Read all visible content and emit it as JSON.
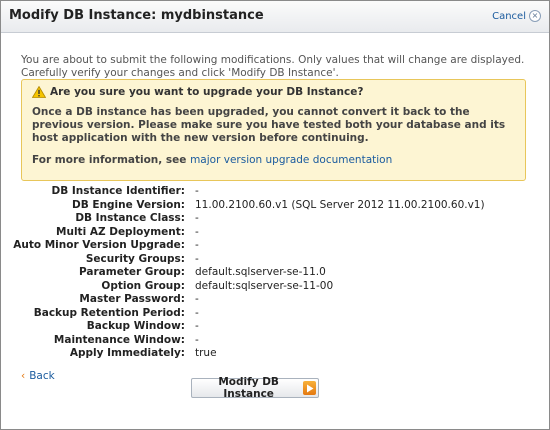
{
  "dialog": {
    "title": "Modify DB Instance: mydbinstance",
    "cancel_label": "Cancel"
  },
  "intro": "You are about to submit the following modifications. Only values that will change are displayed. Carefully verify your changes and click 'Modify DB Instance'.",
  "warning": {
    "heading": "Are you sure you want to upgrade your DB Instance?",
    "body": "Once a DB instance has been upgraded, you cannot convert it back to the previous version. Please make sure you have tested both your database and its host application with the new version before continuing.",
    "more_prefix": "For more information, see",
    "more_link": "major version upgrade documentation"
  },
  "details": [
    {
      "label": "DB Instance Identifier:",
      "value": "-"
    },
    {
      "label": "DB Engine Version:",
      "value": "11.00.2100.60.v1 (SQL Server 2012 11.00.2100.60.v1)"
    },
    {
      "label": "DB Instance Class:",
      "value": "-"
    },
    {
      "label": "Multi AZ Deployment:",
      "value": "-"
    },
    {
      "label": "Auto Minor Version Upgrade:",
      "value": "-"
    },
    {
      "label": "Security Groups:",
      "value": "-"
    },
    {
      "label": "Parameter Group:",
      "value": "default.sqlserver-se-11.0"
    },
    {
      "label": "Option Group:",
      "value": "default:sqlserver-se-11-00"
    },
    {
      "label": "Master Password:",
      "value": "-"
    },
    {
      "label": "Backup Retention Period:",
      "value": "-"
    },
    {
      "label": "Backup Window:",
      "value": "-"
    },
    {
      "label": "Maintenance Window:",
      "value": "-"
    },
    {
      "label": "Apply Immediately:",
      "value": "true"
    }
  ],
  "footer": {
    "back_label": "Back",
    "modify_label": "Modify DB Instance"
  },
  "colors": {
    "link": "#1a5b9e",
    "warning_bg": "#fdf5d3",
    "warning_border": "#e8c65a",
    "accent_orange": "#e47911"
  },
  "icons": {
    "cancel": "close-circle-icon",
    "warning": "warning-triangle-icon",
    "back": "chevron-left-icon",
    "modify": "arrow-right-icon"
  }
}
